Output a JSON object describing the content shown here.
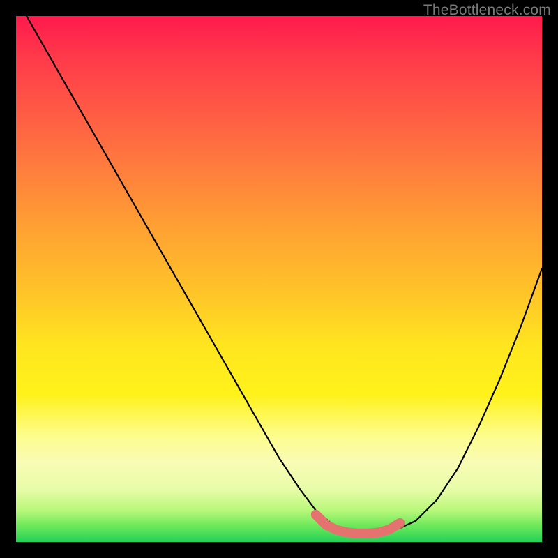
{
  "watermark": "TheBottleneck.com",
  "chart_data": {
    "type": "line",
    "title": "",
    "xlabel": "",
    "ylabel": "",
    "xlim": [
      0,
      100
    ],
    "ylim": [
      0,
      100
    ],
    "grid": false,
    "legend": false,
    "series": [
      {
        "name": "bottleneck-curve",
        "color": "#000000",
        "x": [
          2,
          6,
          10,
          14,
          18,
          22,
          26,
          30,
          34,
          38,
          42,
          46,
          50,
          54,
          57,
          60,
          63,
          66,
          69,
          72,
          76,
          80,
          84,
          88,
          92,
          96,
          100
        ],
        "y": [
          100,
          93,
          86,
          79,
          72,
          65,
          58,
          51,
          44,
          37,
          30,
          23,
          16,
          10,
          6,
          3.5,
          2.2,
          1.6,
          1.6,
          2.2,
          4,
          8,
          14,
          22,
          31,
          41,
          52
        ]
      },
      {
        "name": "optimal-band",
        "color": "#e4736f",
        "x": [
          57,
          59,
          61,
          63,
          65,
          67,
          69,
          71,
          73
        ],
        "y": [
          5.2,
          3.2,
          2.3,
          1.8,
          1.6,
          1.6,
          1.8,
          2.4,
          3.6
        ]
      }
    ],
    "background_gradient_stops": [
      {
        "pos": 0,
        "color": "#ff1a4d"
      },
      {
        "pos": 18,
        "color": "#ff5a45"
      },
      {
        "pos": 40,
        "color": "#ffa033"
      },
      {
        "pos": 63,
        "color": "#ffe61f"
      },
      {
        "pos": 85,
        "color": "#f8fcb5"
      },
      {
        "pos": 100,
        "color": "#23d158"
      }
    ]
  }
}
